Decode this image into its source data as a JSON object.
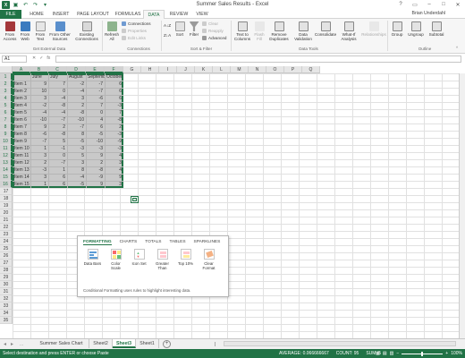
{
  "window": {
    "title": "Summer Sales Results - Excel",
    "user": "Brian Underdahl"
  },
  "ribbon_tabs": [
    "FILE",
    "HOME",
    "INSERT",
    "PAGE LAYOUT",
    "FORMULAS",
    "DATA",
    "REVIEW",
    "VIEW"
  ],
  "active_ribbon_tab": "DATA",
  "ribbon": {
    "from_access": "From Access",
    "from_web": "From Web",
    "from_text": "From Text",
    "from_other": "From Other Sources",
    "existing_conn": "Existing Connections",
    "group_external": "Get External Data",
    "refresh_all": "Refresh All",
    "connections": "Connections",
    "properties": "Properties",
    "edit_links": "Edit Links",
    "group_connections": "Connections",
    "sort_az": "A↓Z",
    "sort_za": "Z↓A",
    "sort": "Sort",
    "filter": "Filter",
    "clear": "Clear",
    "reapply": "Reapply",
    "advanced": "Advanced",
    "group_sortfilter": "Sort & Filter",
    "text_to_columns": "Text to Columns",
    "flash_fill": "Flash Fill",
    "remove_duplicates": "Remove Duplicates",
    "data_validation": "Data Validation",
    "consolidate": "Consolidate",
    "what_if": "What-If Analysis",
    "relationships": "Relationships",
    "group_datatools": "Data Tools",
    "group_btn": "Group",
    "ungroup_btn": "Ungroup",
    "subtotal_btn": "Subtotal",
    "group_outline": "Outline"
  },
  "formula_bar": {
    "name_box": "A1",
    "fx": "fx",
    "cancel": "✕",
    "enter": "✓",
    "value": ""
  },
  "columns": [
    "A",
    "B",
    "C",
    "D",
    "E",
    "F",
    "G",
    "H",
    "I",
    "J",
    "K",
    "L",
    "M",
    "N",
    "O",
    "P",
    "Q"
  ],
  "rows": [
    "1",
    "2",
    "3",
    "4",
    "5",
    "6",
    "7",
    "8",
    "9",
    "10",
    "11",
    "12",
    "13",
    "14",
    "15",
    "16",
    "17",
    "18",
    "19",
    "20",
    "21",
    "22",
    "23",
    "24",
    "25",
    "26",
    "27",
    "28",
    "29",
    "30",
    "31",
    "32",
    "33",
    "34",
    "35"
  ],
  "sheet": {
    "headers": [
      "June",
      "July",
      "August",
      "September",
      "October"
    ],
    "items": [
      {
        "name": "Item 1",
        "values": [
          9,
          7,
          -2,
          -7,
          6
        ]
      },
      {
        "name": "Item 2",
        "values": [
          10,
          0,
          -4,
          -7,
          6
        ]
      },
      {
        "name": "Item 3",
        "values": [
          3,
          -4,
          3,
          -6,
          6
        ]
      },
      {
        "name": "Item 4",
        "values": [
          -2,
          -8,
          2,
          7,
          -3
        ]
      },
      {
        "name": "Item 5",
        "values": [
          -4,
          -4,
          -8,
          0,
          7
        ]
      },
      {
        "name": "Item 6",
        "values": [
          -10,
          -7,
          -10,
          4,
          -8
        ]
      },
      {
        "name": "Item 7",
        "values": [
          9,
          2,
          -7,
          6,
          2
        ]
      },
      {
        "name": "Item 8",
        "values": [
          -6,
          -8,
          8,
          -5,
          -3
        ]
      },
      {
        "name": "Item 9",
        "values": [
          -7,
          5,
          -5,
          -10,
          -9
        ]
      },
      {
        "name": "Item 10",
        "values": [
          1,
          -1,
          -3,
          -3,
          -3
        ]
      },
      {
        "name": "Item 11",
        "values": [
          3,
          0,
          5,
          9,
          4
        ]
      },
      {
        "name": "Item 12",
        "values": [
          2,
          -7,
          3,
          2,
          3
        ]
      },
      {
        "name": "Item 13",
        "values": [
          -3,
          1,
          8,
          -8,
          4
        ]
      },
      {
        "name": "Item 14",
        "values": [
          3,
          6,
          -4,
          -9,
          9
        ]
      },
      {
        "name": "Item 15",
        "values": [
          1,
          6,
          -5,
          9,
          3
        ]
      }
    ]
  },
  "quick_analysis": {
    "tabs": [
      "FORMATTING",
      "CHARTS",
      "TOTALS",
      "TABLES",
      "SPARKLINES"
    ],
    "active_tab": "FORMATTING",
    "items": [
      {
        "label": "Data Bars",
        "icon": "data-bars-icon"
      },
      {
        "label": "Color Scale",
        "icon": "color-scale-icon"
      },
      {
        "label": "Icon Set",
        "icon": "icon-set-icon"
      },
      {
        "label": "Greater Than",
        "icon": "greater-than-icon"
      },
      {
        "label": "Top 10%",
        "icon": "top10-icon"
      },
      {
        "label": "Clear Format",
        "icon": "clear-format-icon"
      }
    ],
    "hint": "Conditional Formatting uses rules to highlight interesting data."
  },
  "sheet_tabs": [
    "Summer Sales Chart",
    "Sheet2",
    "Sheet3",
    "Sheet1"
  ],
  "active_sheet": "Sheet3",
  "status": {
    "message": "Select destination and press ENTER or choose Paste",
    "average": "AVERAGE: 0.066666667",
    "count": "COUNT: 95",
    "sum": "SUM: 5",
    "zoom": "100%"
  },
  "colors": {
    "accent": "#217346",
    "selection": "#c9c9c9"
  }
}
